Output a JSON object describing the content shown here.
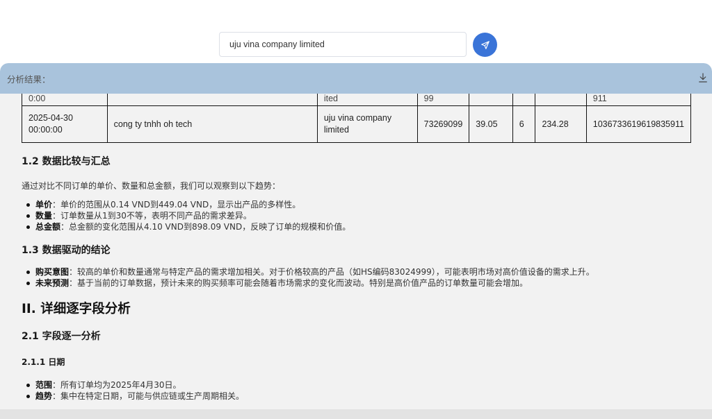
{
  "search": {
    "value": "uju vina company limited"
  },
  "panel": {
    "title": "分析结果："
  },
  "table": {
    "partial_row": [
      "0:00",
      "",
      "ited",
      "99",
      "",
      "",
      "",
      "911"
    ],
    "full_row": [
      "2025-04-30 00:00:00",
      "cong ty tnhh oh tech",
      "uju vina company limited",
      "73269099",
      "39.05",
      "6",
      "234.28",
      "1036733619619835911"
    ]
  },
  "sections": {
    "s12_title": "1.2 数据比较与汇总",
    "s12_intro": "通过对比不同订单的单价、数量和总金额，我们可以观察到以下趋势：",
    "s12_items": [
      {
        "label": "单价",
        "text": "：单价的范围从0.14 VND到449.04 VND，显示出产品的多样性。"
      },
      {
        "label": "数量",
        "text": "：订单数量从1到30不等，表明不同产品的需求差异。"
      },
      {
        "label": "总金额",
        "text": "：总金额的变化范围从4.10 VND到898.09 VND，反映了订单的规模和价值。"
      }
    ],
    "s13_title": "1.3 数据驱动的结论",
    "s13_items": [
      {
        "label": "购买意图",
        "text": "：较高的单价和数量通常与特定产品的需求增加相关。对于价格较高的产品（如HS编码83024999），可能表明市场对高价值设备的需求上升。"
      },
      {
        "label": "未来预测",
        "text": "：基于当前的订单数据，预计未来的购买频率可能会随着市场需求的变化而波动。特别是高价值产品的订单数量可能会增加。"
      }
    ],
    "s2_title": "II. 详细逐字段分析",
    "s21_title": "2.1 字段逐一分析",
    "s211_title": "2.1.1 日期",
    "s211_items": [
      {
        "label": "范围",
        "text": "：所有订单均为2025年4月30日。"
      },
      {
        "label": "趋势",
        "text": "：集中在特定日期，可能与供应链或生产周期相关。"
      }
    ]
  }
}
